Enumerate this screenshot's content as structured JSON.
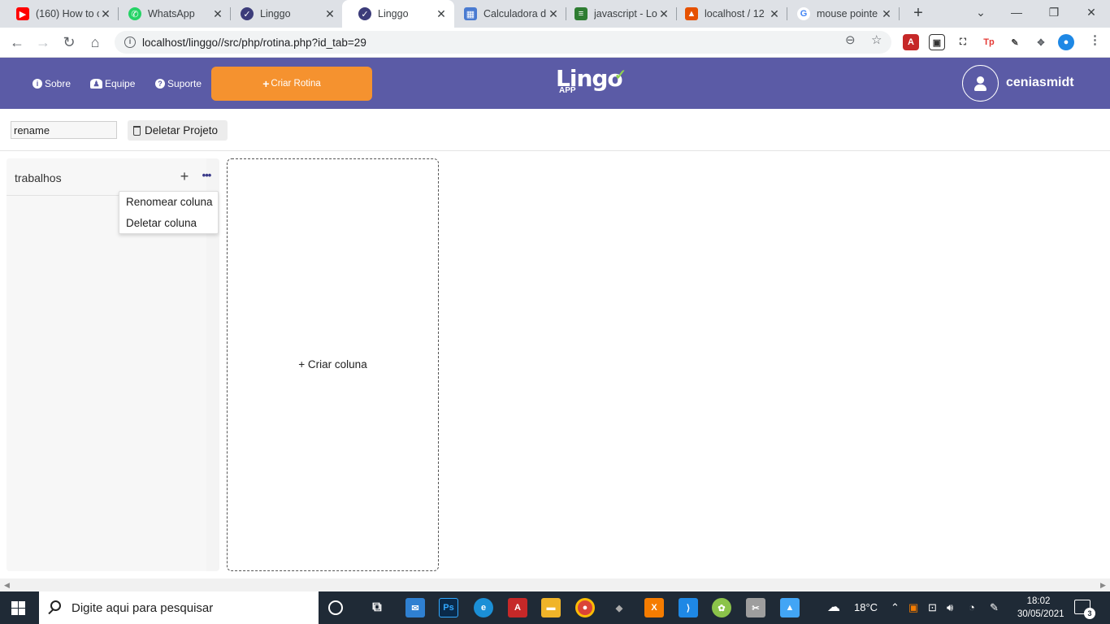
{
  "browser": {
    "tabs": [
      {
        "title": "(160) How to c",
        "favicon_color": "#ff0000",
        "favicon": "youtube-icon"
      },
      {
        "title": "WhatsApp",
        "favicon_color": "#25d366",
        "favicon": "whatsapp-icon"
      },
      {
        "title": "Linggo",
        "favicon_color": "#3c3c7a",
        "favicon": "linggo-icon"
      },
      {
        "title": "Linggo",
        "favicon_color": "#3c3c7a",
        "favicon": "linggo-icon",
        "active": true
      },
      {
        "title": "Calculadora d",
        "favicon_color": "#4a7bd1",
        "favicon": "grid-icon"
      },
      {
        "title": "javascript - Lo",
        "favicon_color": "#2e7d32",
        "favicon": "stackoverflow-icon"
      },
      {
        "title": "localhost / 12",
        "favicon_color": "#e65100",
        "favicon": "phpmyadmin-icon"
      },
      {
        "title": "mouse pointe",
        "favicon_color": "#4285f4",
        "favicon": "google-icon"
      }
    ],
    "url": "localhost/linggo//src/php/rotina.php?id_tab=29"
  },
  "app": {
    "nav": {
      "sobre": "Sobre",
      "equipe": "Equipe",
      "suporte": "Suporte",
      "criar_rotina": "Criar Rotina"
    },
    "logo": {
      "main": "Lingo",
      "sub": "APP"
    },
    "username": "ceniasmidt",
    "colors": {
      "header": "#5b5ba6",
      "accent": "#f5922f"
    }
  },
  "project": {
    "rename_value": "rename",
    "delete_label": "Deletar Projeto"
  },
  "board": {
    "columns": [
      {
        "title": "trabalhos"
      }
    ],
    "column_menu": {
      "rename": "Renomear coluna",
      "delete": "Deletar coluna"
    },
    "new_column_label": "+ Criar coluna"
  },
  "taskbar": {
    "search_placeholder": "Digite aqui para pesquisar",
    "weather": "18°C",
    "time": "18:02",
    "date": "30/05/2021",
    "notifications": "3"
  }
}
